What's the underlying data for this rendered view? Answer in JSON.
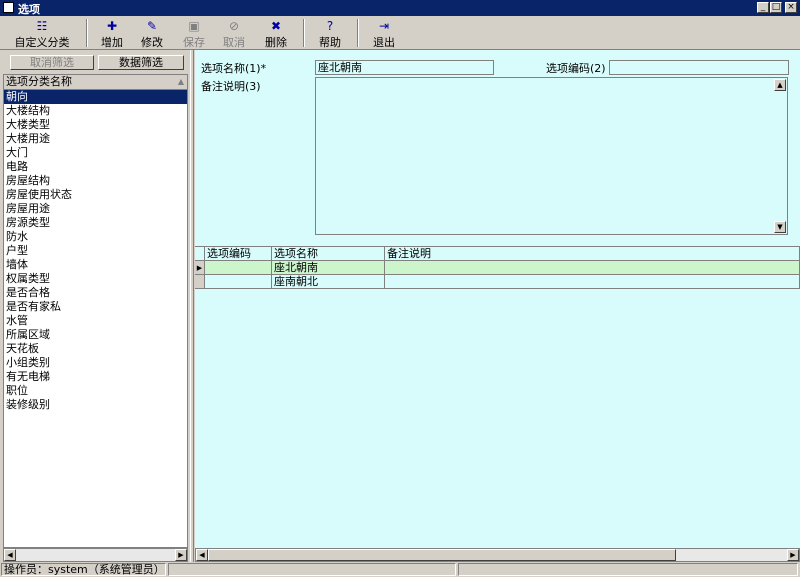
{
  "window": {
    "title": "选项"
  },
  "toolbar": {
    "buttons": [
      {
        "label": "自定义分类",
        "icon": "list-icon",
        "glyph": "☷",
        "disabled": false
      },
      {
        "label": "增加",
        "icon": "add-icon",
        "glyph": "✚",
        "disabled": false
      },
      {
        "label": "修改",
        "icon": "edit-icon",
        "glyph": "✎",
        "disabled": false
      },
      {
        "label": "保存",
        "icon": "save-icon",
        "glyph": "▣",
        "disabled": true
      },
      {
        "label": "取消",
        "icon": "cancel-icon",
        "glyph": "⊘",
        "disabled": true
      },
      {
        "label": "删除",
        "icon": "delete-icon",
        "glyph": "✖",
        "disabled": false
      },
      {
        "label": "帮助",
        "icon": "help-icon",
        "glyph": "?",
        "disabled": false
      },
      {
        "label": "退出",
        "icon": "exit-icon",
        "glyph": "⇥",
        "disabled": false
      }
    ]
  },
  "filter": {
    "cancel_label": "取消筛选",
    "data_label": "数据筛选"
  },
  "category_list": {
    "header": "选项分类名称",
    "items": [
      "朝向",
      "大楼结构",
      "大楼类型",
      "大楼用途",
      "大门",
      "电路",
      "房屋结构",
      "房屋使用状态",
      "房屋用途",
      "房源类型",
      "防水",
      "户型",
      "墙体",
      "权属类型",
      "是否合格",
      "是否有家私",
      "水管",
      "所属区域",
      "天花板",
      "小组类别",
      "有无电梯",
      "职位",
      "装修级别"
    ],
    "selected": "朝向"
  },
  "form": {
    "name_label": "选项名称(1)*",
    "name_value": "座北朝南",
    "code_label": "选项编码(2)",
    "code_value": "",
    "note_label": "备注说明(3)"
  },
  "grid": {
    "columns": [
      "选项编码",
      "选项名称",
      "备注说明"
    ],
    "rows": [
      {
        "code": "",
        "name": "座北朝南",
        "note": ""
      },
      {
        "code": "",
        "name": "座南朝北",
        "note": ""
      }
    ]
  },
  "status": {
    "operator": "操作员：system（系统管理员）"
  },
  "colors": {
    "titlebar": "#0a246a",
    "form_background": "#d8fcfc",
    "selected_row": "#ccf5cc",
    "window_face": "#d4d0c8"
  }
}
